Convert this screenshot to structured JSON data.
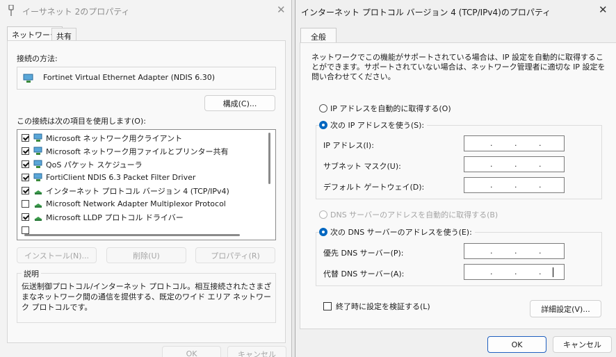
{
  "back_window": {
    "title": "イーサネット 2のプロパティ",
    "tabs": [
      {
        "label": "ネットワーク"
      },
      {
        "label": "共有"
      }
    ],
    "connect_using_label": "接続の方法:",
    "adapter_name": "Fortinet Virtual Ethernet Adapter (NDIS 6.30)",
    "configure_button": "構成(C)...",
    "items_label": "この接続は次の項目を使用します(O):",
    "components": [
      {
        "label": "Microsoft ネットワーク用クライアント",
        "checked": true,
        "icon": "network-client-icon"
      },
      {
        "label": "Microsoft ネットワーク用ファイルとプリンター共有",
        "checked": true,
        "icon": "file-printer-sharing-icon"
      },
      {
        "label": "QoS パケット スケジューラ",
        "checked": true,
        "icon": "qos-icon"
      },
      {
        "label": "FortiClient NDIS 6.3 Packet Filter Driver",
        "checked": true,
        "icon": "filter-driver-icon"
      },
      {
        "label": "インターネット プロトコル バージョン 4 (TCP/IPv4)",
        "checked": true,
        "icon": "protocol-icon"
      },
      {
        "label": "Microsoft Network Adapter Multiplexor Protocol",
        "checked": false,
        "icon": "protocol-icon"
      },
      {
        "label": "Microsoft LLDP プロトコル ドライバー",
        "checked": true,
        "icon": "protocol-icon"
      }
    ],
    "install_button": "インストール(N)...",
    "uninstall_button": "削除(U)",
    "properties_button": "プロパティ(R)",
    "description_heading": "説明",
    "description_text": "伝送制御プロトコル/インターネット プロトコル。相互接続されたさまざまなネットワーク間の通信を提供する、既定のワイド エリア ネットワーク プロトコルです。",
    "ok_button": "OK",
    "cancel_button": "キャンセル"
  },
  "front_window": {
    "title": "インターネット プロトコル バージョン 4 (TCP/IPv4)のプロパティ",
    "tab": "全般",
    "intro": "ネットワークでこの機能がサポートされている場合は、IP 設定を自動的に取得することができます。サポートされていない場合は、ネットワーク管理者に適切な IP 設定を問い合わせてください。",
    "ip_auto_label": "IP アドレスを自動的に取得する(O)",
    "ip_manual_label": "次の IP アドレスを使う(S):",
    "ip_mode": "manual",
    "ip_address_label": "IP アドレス(I):",
    "subnet_label": "サブネット マスク(U):",
    "gateway_label": "デフォルト ゲートウェイ(D):",
    "ip_address_value": ". . .",
    "subnet_value": ". . .",
    "gateway_value": ". . .",
    "dns_auto_label": "DNS サーバーのアドレスを自動的に取得する(B)",
    "dns_manual_label": "次の DNS サーバーのアドレスを使う(E):",
    "dns_mode": "manual",
    "preferred_dns_label": "優先 DNS サーバー(P):",
    "alternate_dns_label": "代替 DNS サーバー(A):",
    "preferred_dns_value": ". . .",
    "alternate_dns_value": ". . .",
    "validate_label": "終了時に設定を検証する(L)",
    "validate_checked": false,
    "advanced_button": "詳細設定(V)...",
    "ok_button": "OK",
    "cancel_button": "キャンセル"
  },
  "colors": {
    "accent": "#0067c0",
    "disabled_text": "#a5a5a5"
  }
}
